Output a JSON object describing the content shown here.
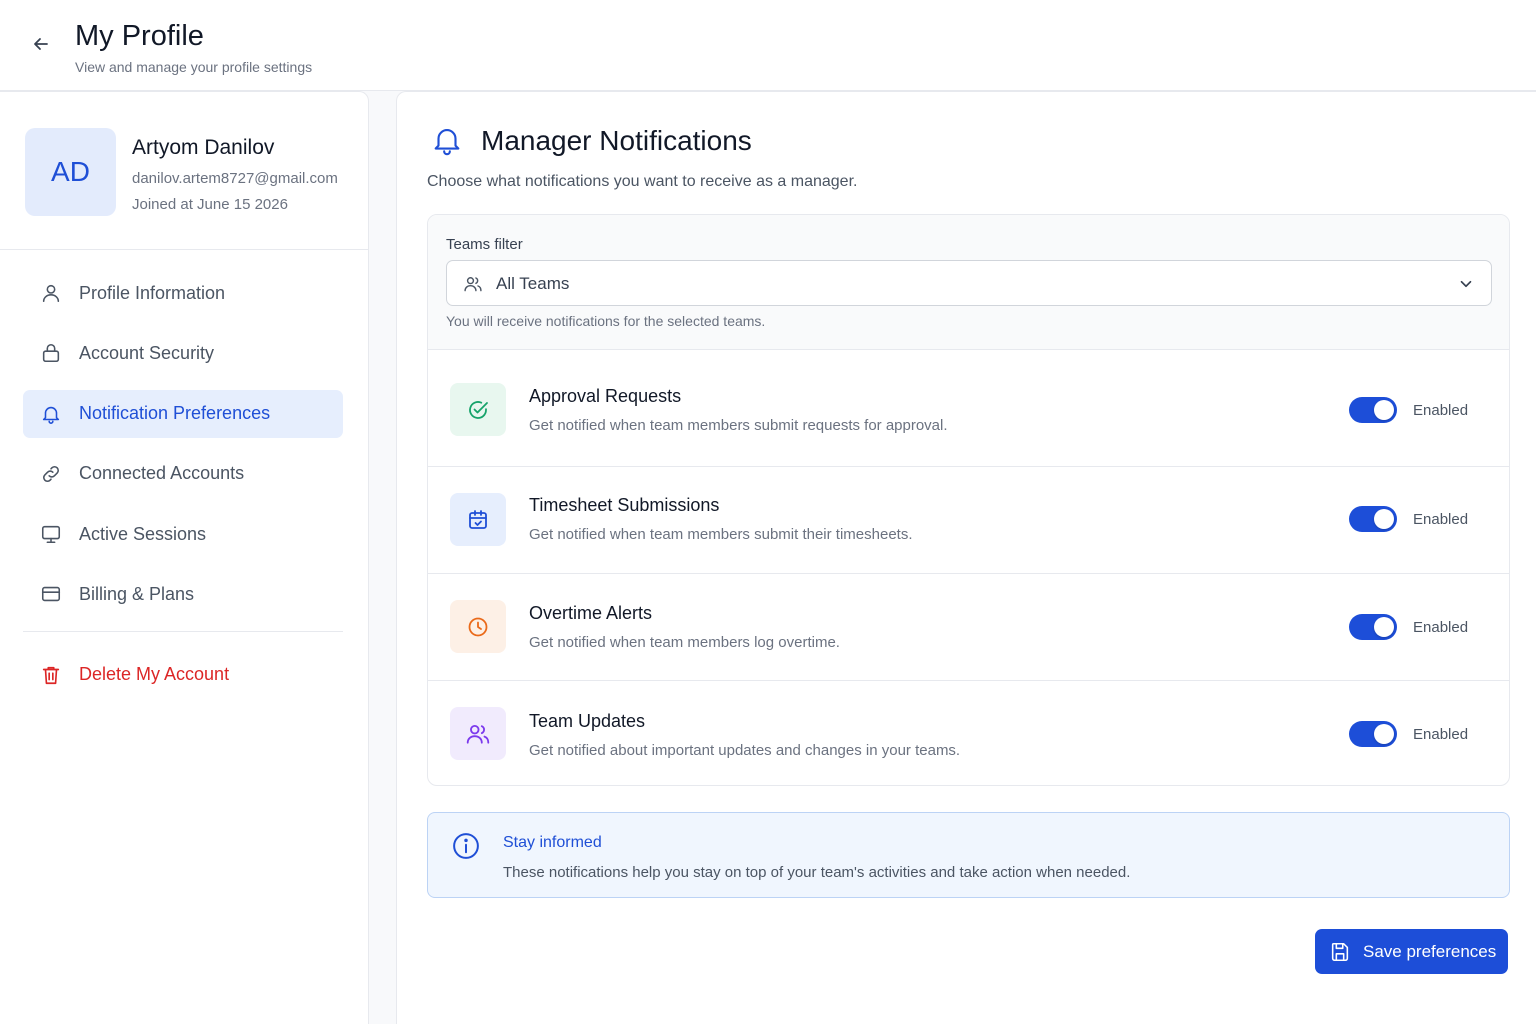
{
  "header": {
    "title": "My Profile",
    "subtitle": "View and manage your profile settings"
  },
  "profile": {
    "initials": "AD",
    "name": "Artyom Danilov",
    "email": "danilov.artem8727@gmail.com",
    "joined": "Joined at June 15 2026"
  },
  "sidebar": {
    "items": [
      {
        "label": "Profile Information",
        "icon": "user-icon"
      },
      {
        "label": "Account Security",
        "icon": "lock-icon"
      },
      {
        "label": "Notification Preferences",
        "icon": "bell-icon",
        "active": true
      },
      {
        "label": "Connected Accounts",
        "icon": "link-icon"
      },
      {
        "label": "Active Sessions",
        "icon": "monitor-icon"
      },
      {
        "label": "Billing & Plans",
        "icon": "credit-card-icon"
      }
    ],
    "delete_label": "Delete My Account"
  },
  "main": {
    "title": "Manager Notifications",
    "description": "Choose what notifications you want to receive as a manager.",
    "filter": {
      "label": "Teams filter",
      "value": "All Teams",
      "hint": "You will receive notifications for the selected teams."
    },
    "preferences": [
      {
        "title": "Approval Requests",
        "description": "Get notified when team members submit requests for approval.",
        "status": "Enabled",
        "enabled": true,
        "icon": "check-circle-icon"
      },
      {
        "title": "Timesheet Submissions",
        "description": "Get notified when team members submit their timesheets.",
        "status": "Enabled",
        "enabled": true,
        "icon": "calendar-icon"
      },
      {
        "title": "Overtime Alerts",
        "description": "Get notified when team members log overtime.",
        "status": "Enabled",
        "enabled": true,
        "icon": "clock-icon"
      },
      {
        "title": "Team Updates",
        "description": "Get notified about important updates and changes in your teams.",
        "status": "Enabled",
        "enabled": true,
        "icon": "users-icon"
      }
    ],
    "info": {
      "title": "Stay informed",
      "text": "These notifications help you stay on top of your team's activities and take action when needed."
    },
    "save_label": "Save preferences"
  },
  "colors": {
    "accent": "#1d4ed8",
    "danger": "#dc2626",
    "approval_icon_bg": "#e8f7ef",
    "timesheet_icon_bg": "#e6eefd",
    "overtime_icon_bg": "#fdf0e6",
    "team_icon_bg": "#f1ebfd"
  }
}
